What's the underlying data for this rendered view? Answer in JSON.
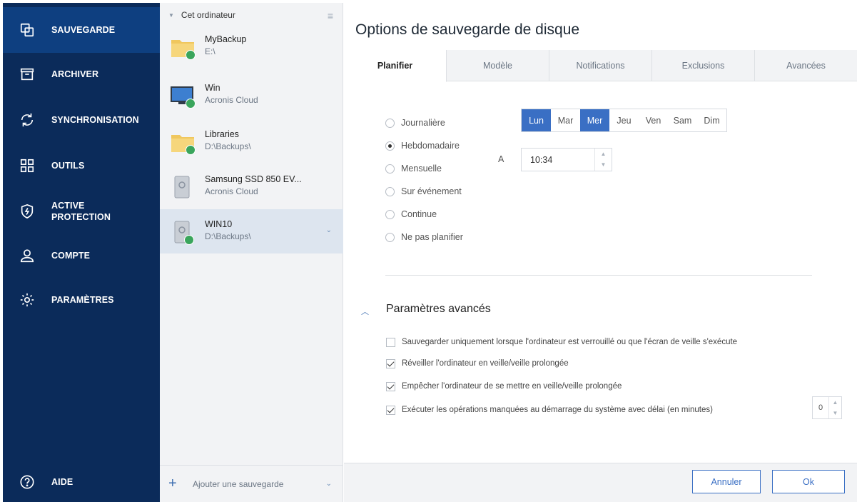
{
  "nav": {
    "items": [
      {
        "label": "SAUVEGARDE",
        "icon": "copy-icon"
      },
      {
        "label": "ARCHIVER",
        "icon": "archive-box-icon"
      },
      {
        "label": "SYNCHRONISATION",
        "icon": "sync-icon"
      },
      {
        "label": "OUTILS",
        "icon": "grid-icon"
      },
      {
        "label1": "ACTIVE",
        "label2": "PROTECTION",
        "icon": "shield-icon"
      },
      {
        "label": "COMPTE",
        "icon": "user-icon"
      },
      {
        "label": "PARAMÈTRES",
        "icon": "gear-icon"
      }
    ],
    "help_label": "AIDE"
  },
  "list": {
    "header": "Cet ordinateur",
    "backups": [
      {
        "name": "MyBackup",
        "sub": "E:\\"
      },
      {
        "name": "Win",
        "sub": "Acronis Cloud"
      },
      {
        "name": "Libraries",
        "sub": "D:\\Backups\\"
      },
      {
        "name": "Samsung SSD 850 EV...",
        "sub": "Acronis Cloud"
      },
      {
        "name": "WIN10",
        "sub": "D:\\Backups\\"
      }
    ],
    "add_label": "Ajouter une sauvegarde"
  },
  "main": {
    "title": "Options de sauvegarde de disque",
    "tabs": [
      "Planifier",
      "Modèle",
      "Notifications",
      "Exclusions",
      "Avancées"
    ],
    "schedule": {
      "options": [
        "Journalière",
        "Hebdomadaire",
        "Mensuelle",
        "Sur événement",
        "Continue",
        "Ne pas planifier"
      ],
      "selected": "Hebdomadaire",
      "days": [
        "Lun",
        "Mar",
        "Mer",
        "Jeu",
        "Ven",
        "Sam",
        "Dim"
      ],
      "selected_days": [
        "Lun",
        "Mer"
      ],
      "at_label": "A",
      "time": "10:34"
    },
    "advanced": {
      "title": "Paramètres avancés",
      "options": [
        {
          "label": "Sauvegarder uniquement lorsque l'ordinateur est verrouillé ou que l'écran de veille s'exécute",
          "checked": false
        },
        {
          "label": "Réveiller l'ordinateur en veille/veille prolongée",
          "checked": true
        },
        {
          "label": "Empêcher l'ordinateur de se mettre en veille/veille prolongée",
          "checked": true
        },
        {
          "label": "Exécuter les opérations manquées au démarrage du système avec délai (en minutes)",
          "checked": true
        }
      ],
      "delay_minutes": "0"
    },
    "buttons": {
      "cancel": "Annuler",
      "ok": "Ok"
    }
  },
  "colors": {
    "nav_bg": "#0b2b5a",
    "nav_active": "#0e3f80",
    "accent": "#3a6fc4",
    "success": "#3aa55c"
  }
}
